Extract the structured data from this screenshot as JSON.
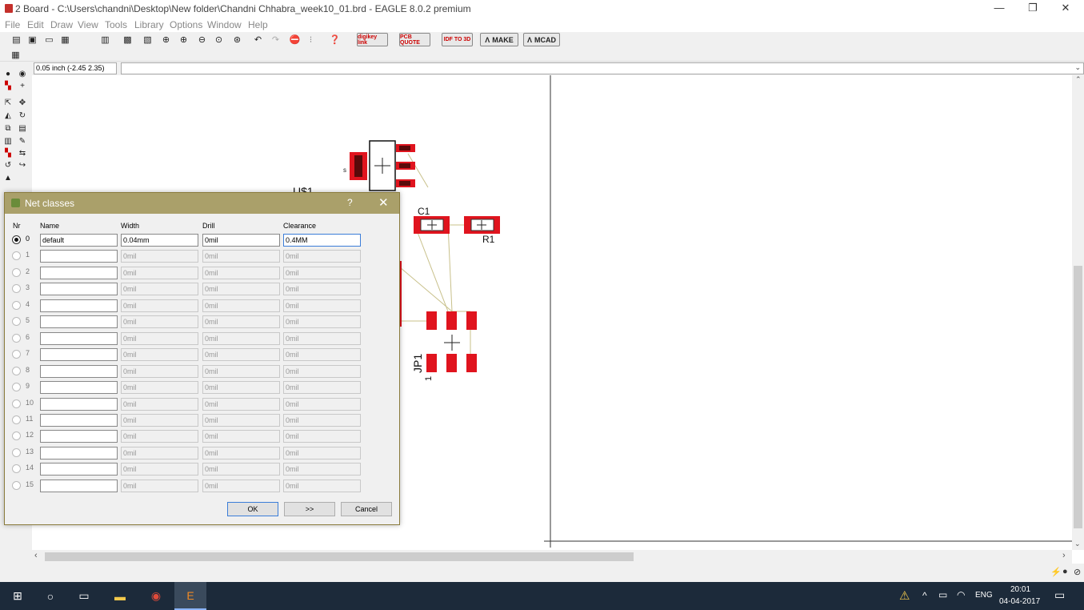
{
  "window": {
    "title": "2 Board - C:\\Users\\chandni\\Desktop\\New folder\\Chandni Chhabra_week10_01.brd - EAGLE 8.0.2 premium",
    "minimize": "—",
    "maximize": "❐",
    "close": "✕"
  },
  "menu": [
    "File",
    "Edit",
    "Draw",
    "View",
    "Tools",
    "Library",
    "Options",
    "Window",
    "Help"
  ],
  "toolbar": {
    "buttons": [
      {
        "label": "digikey link"
      },
      {
        "label": "PCB QUOTE"
      },
      {
        "label": "IDF TO 3D"
      },
      {
        "label": "MAKE"
      },
      {
        "label": "MCAD"
      }
    ]
  },
  "coordinate": "0.05 inch (-2.45 2.35)",
  "canvas": {
    "labels": {
      "u1": "U$1",
      "c1": "C1",
      "r1": "R1",
      "jp1": "JP1",
      "jp1_pin": "1",
      "pad_s": "s"
    }
  },
  "dialog": {
    "title": "Net classes",
    "help": "?",
    "close": "✕",
    "columns": {
      "nr": "Nr",
      "name": "Name",
      "width": "Width",
      "drill": "Drill",
      "clearance": "Clearance"
    },
    "rows": [
      {
        "nr": "0",
        "name": "default",
        "width": "0.04mm",
        "drill": "0mil",
        "clearance": "0.4MM",
        "selected": true
      },
      {
        "nr": "1",
        "name": "",
        "width": "0mil",
        "drill": "0mil",
        "clearance": "0mil"
      },
      {
        "nr": "2",
        "name": "",
        "width": "0mil",
        "drill": "0mil",
        "clearance": "0mil"
      },
      {
        "nr": "3",
        "name": "",
        "width": "0mil",
        "drill": "0mil",
        "clearance": "0mil"
      },
      {
        "nr": "4",
        "name": "",
        "width": "0mil",
        "drill": "0mil",
        "clearance": "0mil"
      },
      {
        "nr": "5",
        "name": "",
        "width": "0mil",
        "drill": "0mil",
        "clearance": "0mil"
      },
      {
        "nr": "6",
        "name": "",
        "width": "0mil",
        "drill": "0mil",
        "clearance": "0mil"
      },
      {
        "nr": "7",
        "name": "",
        "width": "0mil",
        "drill": "0mil",
        "clearance": "0mil"
      },
      {
        "nr": "8",
        "name": "",
        "width": "0mil",
        "drill": "0mil",
        "clearance": "0mil"
      },
      {
        "nr": "9",
        "name": "",
        "width": "0mil",
        "drill": "0mil",
        "clearance": "0mil"
      },
      {
        "nr": "10",
        "name": "",
        "width": "0mil",
        "drill": "0mil",
        "clearance": "0mil"
      },
      {
        "nr": "11",
        "name": "",
        "width": "0mil",
        "drill": "0mil",
        "clearance": "0mil"
      },
      {
        "nr": "12",
        "name": "",
        "width": "0mil",
        "drill": "0mil",
        "clearance": "0mil"
      },
      {
        "nr": "13",
        "name": "",
        "width": "0mil",
        "drill": "0mil",
        "clearance": "0mil"
      },
      {
        "nr": "14",
        "name": "",
        "width": "0mil",
        "drill": "0mil",
        "clearance": "0mil"
      },
      {
        "nr": "15",
        "name": "",
        "width": "0mil",
        "drill": "0mil",
        "clearance": "0mil"
      }
    ],
    "buttons": {
      "ok": "OK",
      "more": ">>",
      "cancel": "Cancel"
    }
  },
  "taskbar": {
    "language": "ENG",
    "time": "20:01",
    "date": "04-04-2017"
  },
  "colors": {
    "pad_red": "#e0141e",
    "dialog_title": "#aaa06a",
    "taskbar": "#1c2a3a",
    "airwire": "#c8c08a"
  }
}
